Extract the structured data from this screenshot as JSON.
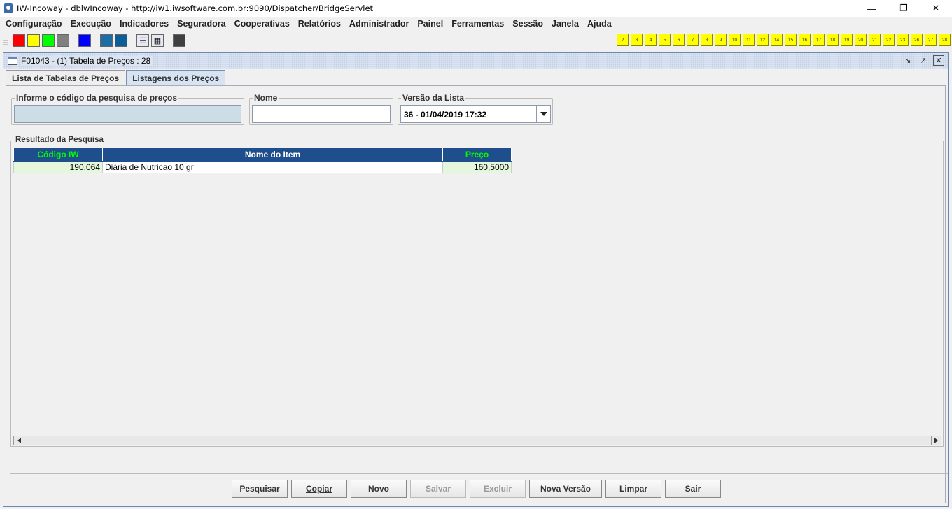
{
  "window": {
    "title": "IW-Incoway - dblwIncoway - http://iw1.iwsoftware.com.br:9090/Dispatcher/BridgeServlet"
  },
  "menu": [
    "Configuração",
    "Execução",
    "Indicadores",
    "Seguradora",
    "Cooperativas",
    "Relatórios",
    "Administrador",
    "Painel",
    "Ferramentas",
    "Sessão",
    "Janela",
    "Ajuda"
  ],
  "toolbar": {
    "color_buttons": [
      "#ff0000",
      "#ffff00",
      "#00ff00",
      "#808080",
      "#0000ff",
      "#1c6ea4",
      "#0d5e96"
    ],
    "window_numbers": [
      "2",
      "3",
      "4",
      "5",
      "6",
      "7",
      "8",
      "9",
      "10",
      "11",
      "12",
      "14",
      "15",
      "16",
      "17",
      "18",
      "19",
      "20",
      "21",
      "22",
      "23",
      "26",
      "27",
      "28"
    ]
  },
  "frame": {
    "title": "F01043 - (1) Tabela de Preços : 28"
  },
  "tabs": [
    "Lista de Tabelas de Preços",
    "Listagens dos Preços"
  ],
  "form": {
    "codigo_label": "Informe o código da pesquisa de preços",
    "codigo_value": "",
    "nome_label": "Nome",
    "nome_value": "",
    "versao_label": "Versão da Lista",
    "versao_value": "36 - 01/04/2019 17:32"
  },
  "result": {
    "label": "Resultado da Pesquisa",
    "columns": [
      "Código IW",
      "Nome do Item",
      "Preço"
    ],
    "rows": [
      [
        "190.064",
        "Diária de Nutricao  10 gr",
        "160,5000"
      ]
    ]
  },
  "buttons": {
    "pesquisar": "Pesquisar",
    "copiar": "Copiar",
    "novo": "Novo",
    "salvar": "Salvar",
    "excluir": "Excluir",
    "nova_versao": "Nova Versão",
    "limpar": "Limpar",
    "sair": "Sair"
  }
}
